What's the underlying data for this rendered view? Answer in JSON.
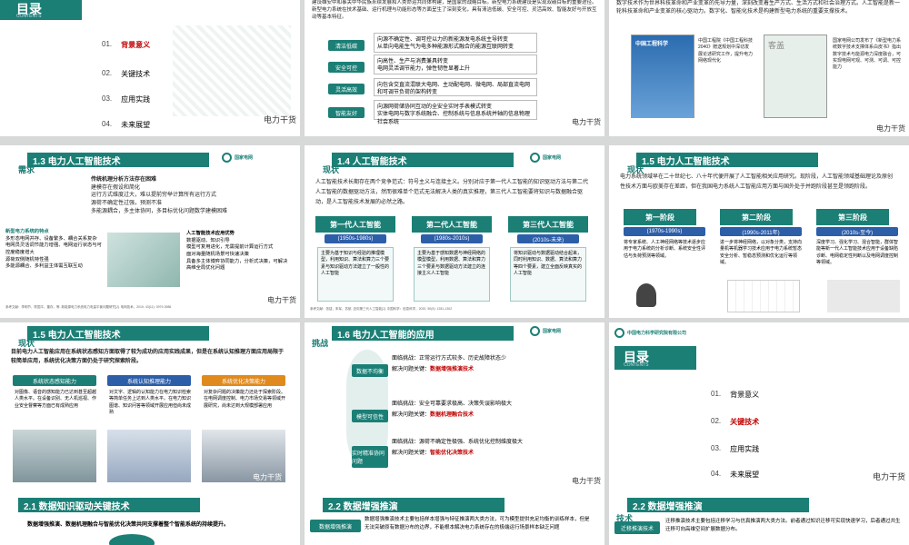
{
  "s1": {
    "title": "目录",
    "subtitle": "CONTENTS",
    "items": [
      {
        "num": "01.",
        "label": "背景意义",
        "red": true
      },
      {
        "num": "02.",
        "label": "关键技术",
        "red": false
      },
      {
        "num": "03.",
        "label": "应用实践",
        "red": false
      },
      {
        "num": "04.",
        "label": "未来展望",
        "red": false
      }
    ],
    "wm": "电力干货"
  },
  "s2": {
    "intro": "建设雄安中和事关中华民族永续发展和人类命运共同体构建，是国家的战略目标。新型电力系统建设是实现双碳目标的重要途径。新型电力系统在技术基础、运行机理与功能形态等方面呈生了深刻变化，具有清洁低碳、安全可控、灵活高效、智能友好与开放互动等基本特征。",
    "rows": [
      {
        "tag": "清洁低碳",
        "lines": [
          "向源不确定性、调可控以力的新能源发电系统主导转变",
          "从单向电能生气为电多种能源形式融合的能源互联网转变"
        ]
      },
      {
        "tag": "安全可控",
        "lines": [
          "向高性、生产与消费兼具转变",
          "电网灵活调节能力，弹性韧性显著上升"
        ]
      },
      {
        "tag": "灵活高效",
        "lines": [
          "向包含交直流混联大电网、主动配电网、微电网、局部直流电网和可调节负荷的架构转变"
        ]
      },
      {
        "tag": "智能友好",
        "lines": [
          "向源网荷储协同互动的全安全实时手表模式转变",
          "实体电网与数字系统融合、控制系统与信息系统并轴的信息物理社会系统"
        ]
      }
    ],
    "wm": "电力干货"
  },
  "s3": {
    "para": "数字技术作为世界科技革命和产业变革的先导力量，深刻改变着生产方式、生活方式和社会治理方式。人工智能是新一轮科技革命和产业变革的核心驱动力。数字化、智能化技术是构建新型电力系统的重要支撑技术。",
    "book": "中国工程科学",
    "book2": "客盖",
    "note1": "中国工程院《中国工程科技2040》赠送规划中深切发展论述研究工作，提升电力网络现代化",
    "note2": "国家电网公司发布了《新型电力系统数字技术支撑体系白皮书》指出数字技术与能源电力深度融合，可实现电网可观、可测、可调、可控能力",
    "wm": "电力干货"
  },
  "s4": {
    "title": "1.3 电力人工智能技术",
    "tag": "需求",
    "head": "传统机理分析方法存在困难",
    "l1": "建模存在假设和简化",
    "l2": "运行方式维度过大，难以提前穷举计算所有运行方式",
    "l3": "源荷不确定性过强，预测不准",
    "l4": "多能源耦合，多主体协同，多目标优化问题数学建模困难",
    "left_head": "新型电力系统的特点",
    "left": [
      "多形态电网并存、设备繁多、耦合关系复杂",
      "电网员灵活调节能力增强、电网运行状态与可控度稳度增大",
      "源荷双侧随机特性强",
      "多能源耦合、多利益主体需互联互动"
    ],
    "right_head": "人工智能技术应用优势",
    "right": [
      "数据驱动、知识引导",
      "模型可复用进化，无需提前计算运行方式",
      "面对海量随机场景可快速决策",
      "具备多主体博弈协同能力，分析式决策，可解决高维全局优化问题"
    ],
    "ref": "参考文献：李明节，陈国平，董存，等. 新能源电力系统电力电量平衡问题研究[J]. 电网技术，2019, 43(11): 3979-3986",
    "wm": "电力干货"
  },
  "s5": {
    "title": "1.4 人工智能技术",
    "tag": "现状",
    "para": "人工智能技术长期存在两个竞争范式：符号主义与连接主义。分别对应于第一代人工智能的知识驱动方法与第二代人工智能的数据驱动方法，然而很难单个范式无法解决人类的真实推理，第三代人工智能要将知识与数据融合驱动，是人工智能技术发展的必然之路。",
    "gens": [
      {
        "name": "第一代人工智能",
        "period": "(1950s-1980s)",
        "desc": "主要为基于知识与经验的推理模型，利用知识、算法和算力三个要素与知识驱动方法建立了一般性的人工智能"
      },
      {
        "name": "第二代人工智能",
        "period": "(1980s-2010s)",
        "desc": "主要为基于感知数据与神经网络的模型模型，利用数据、算法和算力三个要素与数据驱动方法建立的连接主义人工智能"
      },
      {
        "name": "第三代人工智能",
        "period": "(2010s-未来)",
        "desc": "将知识驱动与数据驱动结合起来，同时利用知识、数据、算法和算力等四个要素，建立全面反映真实的人工智能"
      }
    ],
    "ref": "参考文献：张钹，朱军，苏航. 迈向第三代人工智能[J]. 中国科学：信息科学，2020, 50(9): 1281-1302",
    "wm": "电力干货"
  },
  "s6": {
    "title": "1.5 电力人工智能技术",
    "tag": "现状",
    "para": "电力系统领域早在二十世纪七、八十年代便开展了人工智能相关应用研究。现阶段，人工智能领域基础理论及原创性技术方面与欧美存在差距，但在我国电力系统人工智能应用方面与国外处于并跑阶段甚至是领跑阶段。",
    "stages": [
      {
        "name": "第一阶段",
        "period": "(1970s-1990s)",
        "desc": "将专家系统、人工神经网络等技术逐步应用于电力系统的分析诊断、系统安全性评估与负荷预测等领域。"
      },
      {
        "name": "第二阶段",
        "period": "(1990s-2011年)",
        "desc": "进一步将神经网络，以对象分类，支持向量机等机器学习技术应用于电力系统暂态安全分析、暂稳态预测和优化运行等领域。"
      },
      {
        "name": "第三阶段",
        "period": "(2010s-至今)",
        "desc": "深度学习、强化学习、混合智能，群体智能等新一代人工智能技术应用于设备缺陷诊断、电网稳定性判断以及电网调度控制等领域。"
      }
    ],
    "wm": "电力干货"
  },
  "s7": {
    "title": "1.5 电力人工智能技术",
    "tag": "现状",
    "para": "目前电力人工智能应用在系统状态感知方面取得了较为成功的应用实践成果，但是在系统认知推理方面应用局限于较简单应用，系统优化决策方面仍处于研究探索阶段。",
    "cols": [
      {
        "head": "系统状态感知能力",
        "color": "#1b7f76",
        "text": "对图像、语音的感知能力已达到甚至超越人类水平。在设备识别、无人机巡视、作业安全督察等方面已有成熟应用"
      },
      {
        "head": "系统认知推理能力",
        "color": "#2d5ea8",
        "text": "对文字、逻辑的认知能力在电力知识检索等简单任务上达到人类水平。在电力知识图谱、知识问答等领域开展应用但尚未成熟"
      },
      {
        "head": "系统优化决策能力",
        "color": "#e08a1e",
        "text": "对复杂问题的决策能力还处于探索阶段。在电网调度控制、电力市场交易等领域开展研究，尚未达到大规模部署应用"
      }
    ],
    "wm": "电力干货"
  },
  "s8": {
    "title": "1.6 电力人工智能的应用",
    "tag": "挑战",
    "rows": [
      {
        "label": "数据不均衡",
        "a": "面临挑战：正常运行方式较多、历史故障状态少",
        "b": "解决问题关键：",
        "key": "数据增强推演技术"
      },
      {
        "label": "模型可信性",
        "a": "面临挑战：安全可靠要求极高、决策失误影响极大",
        "b": "解决问题关键：",
        "key": "数据机理融合技术"
      },
      {
        "label": "实时精准协同问题",
        "a": "面临挑战：源荷不确定性极强、系统优化控制维度极大",
        "b": "解决问题关键：",
        "key": "智能优化决策技术"
      }
    ],
    "wm": "电力干货"
  },
  "s9": {
    "title": "目录",
    "subtitle": "CONTENTS",
    "company": "中国电力科学研究院有限公司",
    "items": [
      {
        "num": "01.",
        "label": "背景意义",
        "red": false
      },
      {
        "num": "02.",
        "label": "关键技术",
        "red": true
      },
      {
        "num": "03.",
        "label": "应用实践",
        "red": false
      },
      {
        "num": "04.",
        "label": "未来展望",
        "red": false
      }
    ],
    "wm": "电力干货"
  },
  "s10": {
    "title": "2.1 数据知识驱动关键技术",
    "line": "数据增强推演、数据机理融合与智能优化决策共同支撑着整个智能系统的持续提升。"
  },
  "s11": {
    "title": "2.2 数据增强推演",
    "tag": "数据增强推演",
    "para": "数据增强推演技术主要包括样本增强与特征推演两大类方法，可为模型提供充足均衡的训练样本，但是无法突破原有数据分布的边界，不能根本解决电力系统存在的极端运行场景样本缺乏问题"
  },
  "s12": {
    "title": "2.2 数据增强推演",
    "tag": "技术",
    "label": "迁移推演技术",
    "para": "迁移推演技术主要包括迁移学习与仿真推演两大类方法。前者通过知识迁移可实现快速学习，后者通过共生迁移可向高维空间扩展数据分布。"
  }
}
